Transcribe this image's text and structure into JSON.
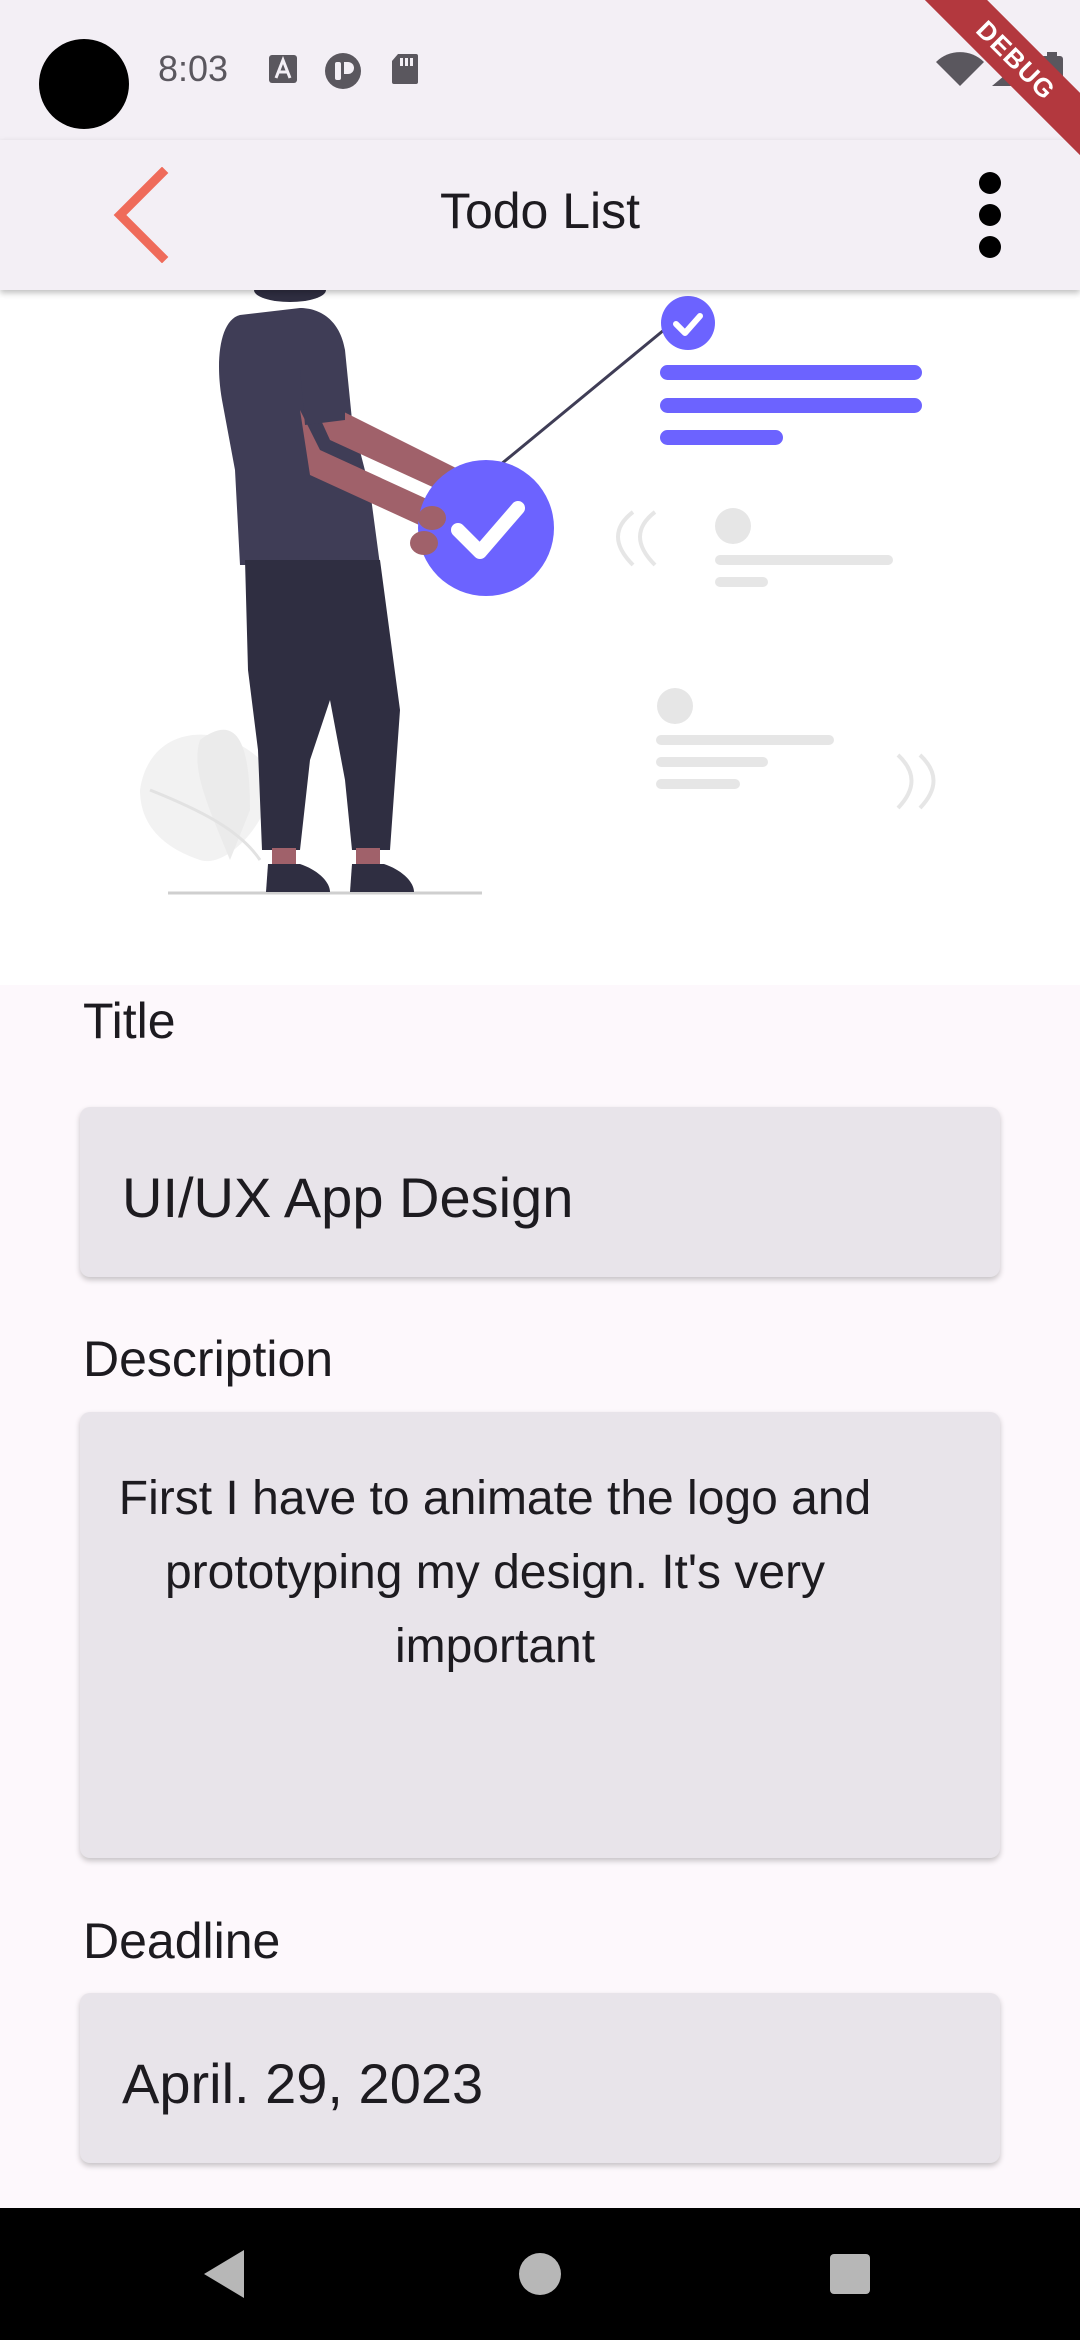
{
  "status_bar": {
    "time": "8:03",
    "icons": [
      "a-notification-icon",
      "tasks-app-icon",
      "sd-card-icon",
      "wifi-icon",
      "signal-icon",
      "battery-icon"
    ],
    "debug_banner": "DEBUG"
  },
  "app_bar": {
    "title": "Todo List",
    "back_icon": "chevron-left-icon",
    "menu_icon": "more-vertical-icon",
    "accent_color": "#ef6b5a"
  },
  "form": {
    "title_label": "Title",
    "title_value": "UI/UX App Design",
    "description_label": "Description",
    "description_value": "First I have to animate the logo and prototyping my design. It's very important",
    "deadline_label": "Deadline",
    "deadline_value": "April. 29, 2023"
  },
  "nav_bar": {
    "buttons": [
      "back-icon",
      "home-icon",
      "recents-icon"
    ]
  },
  "colors": {
    "illustration_accent": "#6c63ff",
    "person_dark": "#3f3d56",
    "field_background": "#e8e4ea"
  }
}
